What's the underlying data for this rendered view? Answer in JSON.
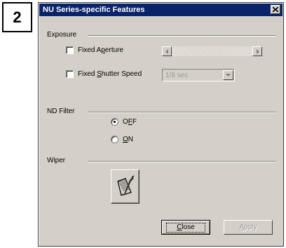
{
  "step_number": "2",
  "dialog": {
    "title": "NU Series-specific Features",
    "close_glyph": "×"
  },
  "exposure": {
    "group_label": "Exposure",
    "fixed_aperture": {
      "pre": "Fixed A",
      "u": "p",
      "post": "erture",
      "checked": false
    },
    "fixed_shutter": {
      "pre": "Fixed ",
      "u": "S",
      "post": "hutter Speed",
      "checked": false
    },
    "shutter_value": "1/8 sec"
  },
  "nd_filter": {
    "group_label": "ND Filter",
    "off": {
      "pre": "O",
      "u": "F",
      "post": "F",
      "selected": true
    },
    "on": {
      "pre": "",
      "u": "O",
      "post": "N",
      "selected": false
    }
  },
  "wiper": {
    "group_label": "Wiper",
    "icon": "wiper-icon"
  },
  "buttons": {
    "close": {
      "pre": "",
      "u": "C",
      "post": "lose"
    },
    "apply": {
      "pre": "",
      "u": "A",
      "post": "pply"
    }
  },
  "colors": {
    "title_bar": "#0a246a",
    "dialog_face": "#d4d0c8"
  }
}
